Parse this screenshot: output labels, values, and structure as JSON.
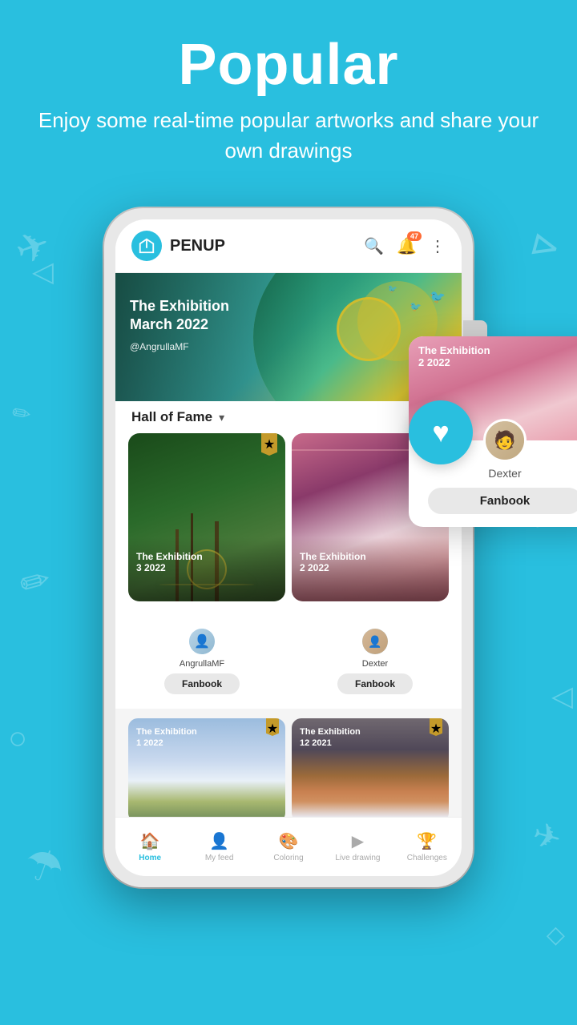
{
  "page": {
    "bg_color": "#29BFDF",
    "title": "Popular",
    "subtitle": "Enjoy some real-time popular artworks and share your own drawings"
  },
  "app": {
    "name": "PENUP",
    "logo_alt": "PENUP logo",
    "notif_count": "47",
    "banner": {
      "title": "The Exhibition\nMarch 2022",
      "author": "@AngrullaMF"
    },
    "section_label": "Hall of Fame",
    "cards": [
      {
        "title": "The Exhibition\n3 2022",
        "username": "AngrullaMF",
        "fanbook_label": "Fanbook"
      },
      {
        "title": "The Exhibition\n2 2022",
        "username": "Dexter",
        "fanbook_label": "Fanbook"
      }
    ],
    "bottom_cards": [
      {
        "title": "The Exhibition\n1 2022"
      },
      {
        "title": "The Exhibition\n12 2021"
      }
    ]
  },
  "nav": {
    "items": [
      {
        "label": "Home",
        "icon": "🏠",
        "active": true
      },
      {
        "label": "My feed",
        "icon": "👤",
        "active": false
      },
      {
        "label": "Coloring",
        "icon": "🎨",
        "active": false
      },
      {
        "label": "Live drawing",
        "icon": "▶",
        "active": false
      },
      {
        "label": "Challenges",
        "icon": "🏆",
        "active": false
      }
    ]
  },
  "icons": {
    "search": "🔍",
    "bell": "🔔",
    "more": "⋮",
    "star": "★",
    "heart": "♥",
    "dropdown": "▾",
    "home_active": "🏠"
  }
}
